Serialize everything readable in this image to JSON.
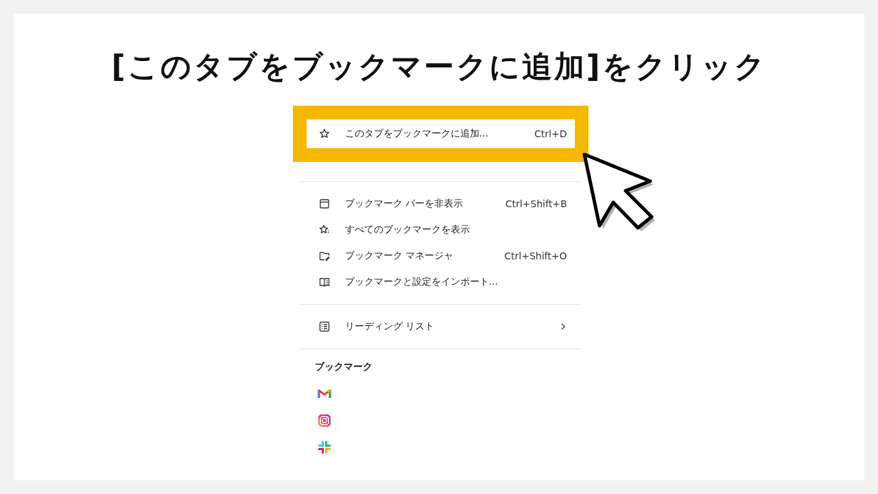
{
  "title": "[このタブをブックマークに追加]をクリック",
  "menu": {
    "sections": [
      {
        "items": [
          {
            "label": "このタブをブックマークに追加...",
            "shortcut": "Ctrl+D",
            "highlighted": true
          }
        ]
      },
      {
        "items": [
          {
            "label": "ブックマーク バーを非表示",
            "shortcut": "Ctrl+Shift+B",
            "highlighted": false
          },
          {
            "label": "すべてのブックマークを表示",
            "highlighted": false
          },
          {
            "label": "ブックマーク マネージャ",
            "shortcut": "Ctrl+Shift+O",
            "highlighted": false
          },
          {
            "label": "ブックマークと設定をインポート...",
            "highlighted": false
          }
        ]
      },
      {
        "items": [
          {
            "label": "リーディング リスト",
            "submenu": true,
            "highlighted": false
          }
        ]
      }
    ],
    "bookmarks_heading": "ブックマーク"
  }
}
